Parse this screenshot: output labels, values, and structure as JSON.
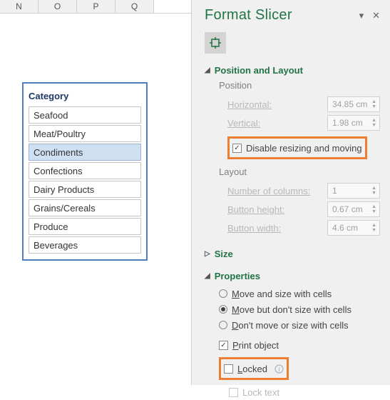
{
  "columns": [
    "N",
    "O",
    "P",
    "Q"
  ],
  "slicer": {
    "title": "Category",
    "items": [
      {
        "label": "Seafood",
        "selected": false
      },
      {
        "label": "Meat/Poultry",
        "selected": false
      },
      {
        "label": "Condiments",
        "selected": true
      },
      {
        "label": "Confections",
        "selected": false
      },
      {
        "label": "Dairy Products",
        "selected": false
      },
      {
        "label": "Grains/Cereals",
        "selected": false
      },
      {
        "label": "Produce",
        "selected": false
      },
      {
        "label": "Beverages",
        "selected": false
      }
    ]
  },
  "pane": {
    "title": "Format Slicer",
    "sections": {
      "posLayout": "Position and Layout",
      "size": "Size",
      "properties": "Properties"
    },
    "position": {
      "group": "Position",
      "horizontal_label": "Horizontal:",
      "vertical_label": "Vertical:",
      "horizontal": "34.85 cm",
      "vertical": "1.98 cm",
      "disable_label": "Disable resizing and moving",
      "disable_checked": true
    },
    "layout": {
      "group": "Layout",
      "numcols_label": "Number of columns:",
      "numcols": "1",
      "bheight_label": "Button height:",
      "bheight": "0.67 cm",
      "bwidth_label": "Button width:",
      "bwidth": "4.6 cm"
    },
    "properties": {
      "opt1": "Move and size with cells",
      "opt2": "Move but don't size with cells",
      "opt3": "Don't move or size with cells",
      "selected": 2,
      "print_label": "Print object",
      "print_checked": true,
      "locked_label": "Locked",
      "locked_checked": false,
      "locktext_label": "Lock text"
    }
  }
}
